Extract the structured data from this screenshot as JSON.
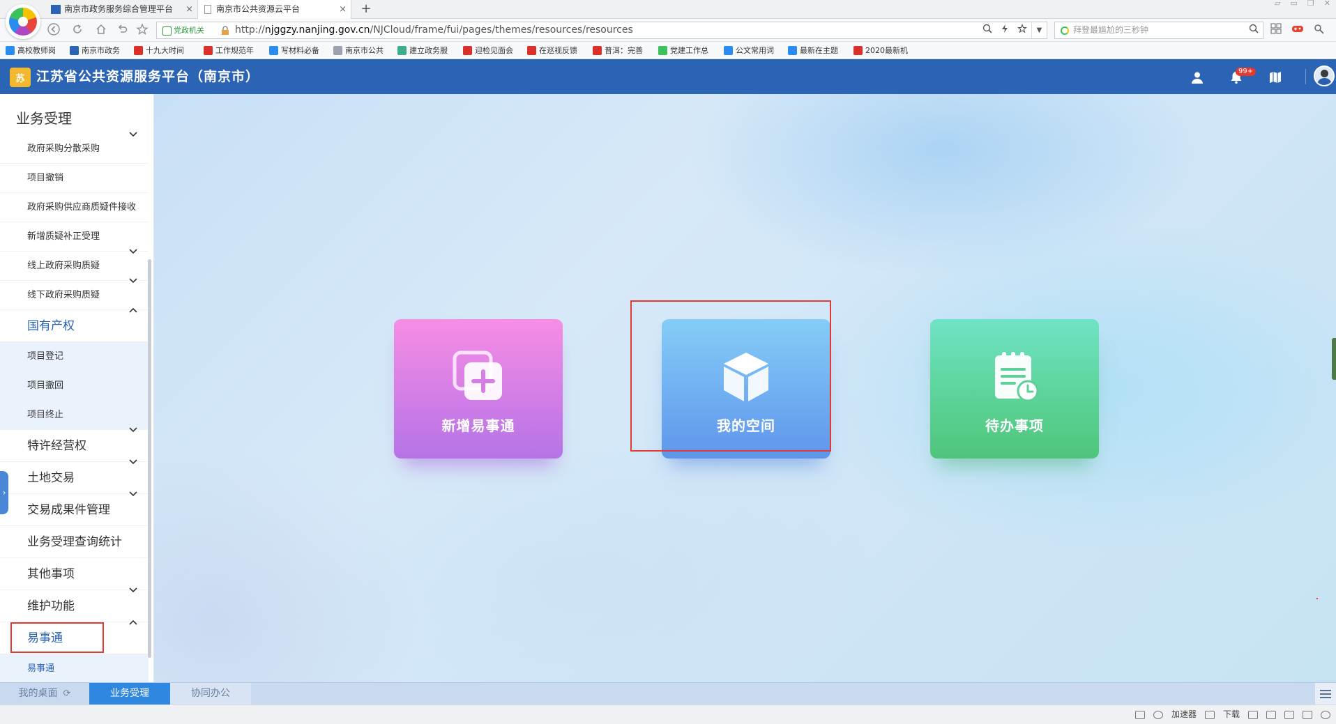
{
  "browser": {
    "tabs": [
      {
        "label": "南京市政务服务综合管理平台",
        "active": false
      },
      {
        "label": "南京市公共资源云平台",
        "active": true
      }
    ],
    "close_glyph": "×",
    "new_tab_glyph": "+",
    "address": {
      "badge": "党政机关",
      "url_prefix": "http://",
      "url_domain": "njggzy.nanjing.gov.cn",
      "url_path": "/NJCloud/frame/fui/pages/themes/resources/resources"
    },
    "search_placeholder": "拜登最尴尬的三秒钟",
    "bookmarks": [
      {
        "label": "高校教师岗",
        "color": "#2a8cf0"
      },
      {
        "label": "南京市政务",
        "color": "#2b63b5"
      },
      {
        "label": "十九大时间",
        "color": "#d9302a"
      },
      {
        "label": "工作规范年",
        "color": "#d9302a"
      },
      {
        "label": "写材料必备",
        "color": "#2a8cf0"
      },
      {
        "label": "南京市公共",
        "color": "#9aa3ad"
      },
      {
        "label": "建立政务服",
        "color": "#3cae8f"
      },
      {
        "label": "迎检见面会",
        "color": "#d9302a"
      },
      {
        "label": "在巡视反馈",
        "color": "#d9302a"
      },
      {
        "label": "普洱：完善",
        "color": "#d9302a"
      },
      {
        "label": "党建工作总",
        "color": "#3cc25a"
      },
      {
        "label": "公文常用词",
        "color": "#2a8cf0"
      },
      {
        "label": "最新在主题",
        "color": "#2a8cf0"
      },
      {
        "label": "2020最新机",
        "color": "#d9302a"
      }
    ]
  },
  "header": {
    "logo_glyph": "苏",
    "title": "江苏省公共资源服务平台（南京市）",
    "notification_count": "99+"
  },
  "sidebar": {
    "title": "业务受理",
    "items": [
      {
        "label": "政府采购分散采购",
        "kind": "sub",
        "chevron": "down"
      },
      {
        "label": "项目撤销",
        "kind": "sub",
        "chevron": ""
      },
      {
        "label": "政府采购供应商质疑件接收",
        "kind": "sub",
        "chevron": ""
      },
      {
        "label": "新增质疑补正受理",
        "kind": "sub",
        "chevron": ""
      },
      {
        "label": "线上政府采购质疑",
        "kind": "sub",
        "chevron": "down"
      },
      {
        "label": "线下政府采购质疑",
        "kind": "sub",
        "chevron": "down"
      },
      {
        "label": "国有产权",
        "kind": "grp-open",
        "chevron": "up"
      },
      {
        "label": "项目登记",
        "kind": "child",
        "chevron": ""
      },
      {
        "label": "项目撤回",
        "kind": "child",
        "chevron": ""
      },
      {
        "label": "项目终止",
        "kind": "child",
        "chevron": ""
      },
      {
        "label": "特许经营权",
        "kind": "grp",
        "chevron": "down"
      },
      {
        "label": "土地交易",
        "kind": "grp",
        "chevron": "down"
      },
      {
        "label": "交易成果件管理",
        "kind": "grp",
        "chevron": "down"
      },
      {
        "label": "业务受理查询统计",
        "kind": "grp",
        "chevron": ""
      },
      {
        "label": "其他事项",
        "kind": "grp",
        "chevron": ""
      },
      {
        "label": "维护功能",
        "kind": "grp",
        "chevron": "down"
      },
      {
        "label": "易事通",
        "kind": "grp-open",
        "chevron": "up"
      },
      {
        "label": "易事通",
        "kind": "child-blue",
        "chevron": ""
      }
    ]
  },
  "main": {
    "cards": [
      {
        "label": "新增易事通",
        "icon": "add-file-icon"
      },
      {
        "label": "我的空间",
        "icon": "cube-icon"
      },
      {
        "label": "待办事项",
        "icon": "clipboard-clock-icon"
      }
    ]
  },
  "bottom_tabs": [
    {
      "label": "我的桌面",
      "active": false
    },
    {
      "label": "业务受理",
      "active": true
    },
    {
      "label": "协同办公",
      "active": false
    }
  ],
  "statusbar": {
    "accelerator": "加速器",
    "download": "下载"
  },
  "colors": {
    "header": "#2b63b5",
    "highlight_box": "#e23a2e",
    "active_tab": "#2f87e0"
  }
}
